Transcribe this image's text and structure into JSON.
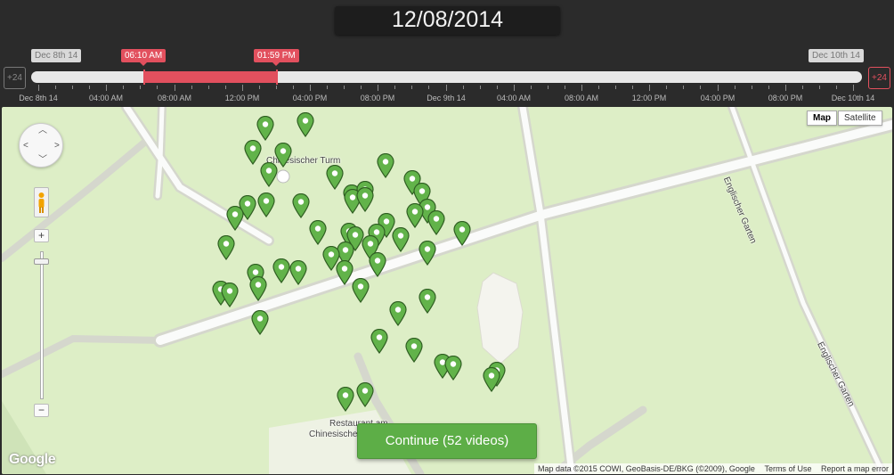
{
  "header": {
    "date": "12/08/2014"
  },
  "timeline": {
    "start_flag": "Dec 8th 14",
    "end_flag": "Dec 10th 14",
    "selection_start": "06:10 AM",
    "selection_end": "01:59 PM",
    "back_button": "+24",
    "forward_button": "+24",
    "tick_labels": [
      "Dec 8th 14",
      "04:00 AM",
      "08:00 AM",
      "12:00 PM",
      "04:00 PM",
      "08:00 PM",
      "Dec 9th 14",
      "04:00 AM",
      "08:00 AM",
      "12:00 PM",
      "04:00 PM",
      "08:00 PM",
      "Dec 10th 14"
    ]
  },
  "map": {
    "type_map": "Map",
    "type_satellite": "Satellite",
    "place_label_1": "Chinesischer Turm",
    "place_label_2_line1": "Restaurant am",
    "place_label_2_line2": "Chinesischen",
    "street_label_1": "Englischer Garten",
    "street_label_2": "Englischer Garten",
    "zoom_in": "+",
    "zoom_out": "−",
    "logo": "Google",
    "attribution": "Map data ©2015 COWI, GeoBasis-DE/BKG (©2009), Google",
    "terms": "Terms of Use",
    "report": "Report a map error",
    "marker_color": "#62b34a"
  },
  "actions": {
    "continue_label": "Continue (52 videos)"
  },
  "colors": {
    "accent_red": "#e2505e",
    "button_green": "#5dae47",
    "park_green": "#ddeec6",
    "path_gray": "#d7d9cf"
  }
}
